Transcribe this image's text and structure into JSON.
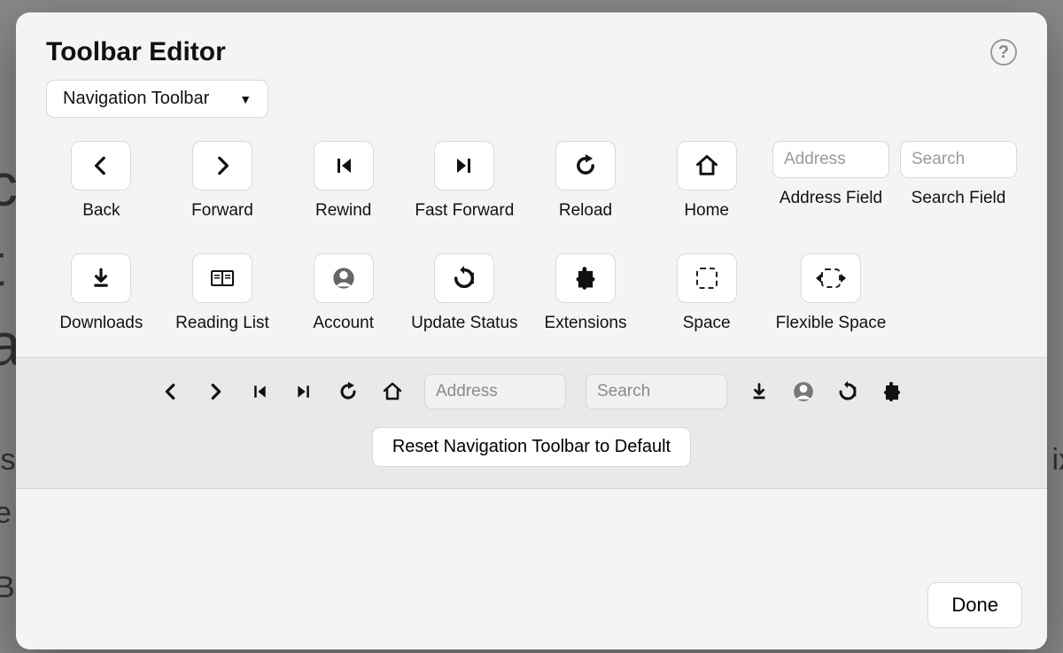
{
  "dialog": {
    "title": "Toolbar Editor",
    "help_tooltip": "?",
    "toolbar_select": {
      "value": "Navigation Toolbar"
    }
  },
  "items": {
    "back": {
      "label": "Back"
    },
    "forward": {
      "label": "Forward"
    },
    "rewind": {
      "label": "Rewind"
    },
    "fast_forward": {
      "label": "Fast Forward"
    },
    "reload": {
      "label": "Reload"
    },
    "home": {
      "label": "Home"
    },
    "address_field": {
      "label": "Address Field",
      "placeholder": "Address"
    },
    "search_field": {
      "label": "Search Field",
      "placeholder": "Search"
    },
    "downloads": {
      "label": "Downloads"
    },
    "reading_list": {
      "label": "Reading List"
    },
    "account": {
      "label": "Account"
    },
    "update_status": {
      "label": "Update Status"
    },
    "extensions": {
      "label": "Extensions"
    },
    "space": {
      "label": "Space"
    },
    "flexible_space": {
      "label": "Flexible Space"
    }
  },
  "preview": {
    "address_placeholder": "Address",
    "search_placeholder": "Search",
    "reset_label": "Reset Navigation Toolbar to Default"
  },
  "footer": {
    "done_label": "Done"
  }
}
